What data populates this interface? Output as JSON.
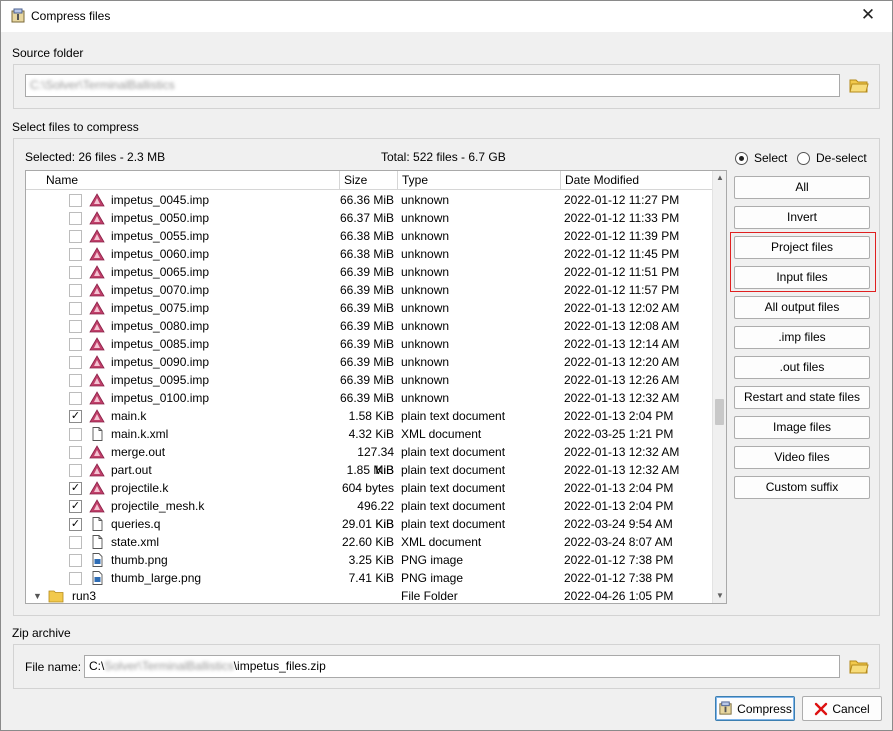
{
  "window": {
    "title": "Compress files",
    "close_glyph": "✕"
  },
  "source": {
    "group_label": "Source folder",
    "path_value": "C:\\Solver\\TerminalBallistics"
  },
  "select_files": {
    "group_label": "Select files to compress",
    "selected_summary": "Selected: 26 files - 2.3 MB",
    "total_summary": "Total: 522 files - 6.7 GB",
    "columns": [
      "Name",
      "Size",
      "Type",
      "Date Modified"
    ],
    "rows": [
      {
        "name": "impetus_0045.imp",
        "size": "66.36 MiB",
        "type": "unknown",
        "date": "2022-01-12 11:27 PM",
        "checked": false,
        "icon": "triangle-icon"
      },
      {
        "name": "impetus_0050.imp",
        "size": "66.37 MiB",
        "type": "unknown",
        "date": "2022-01-12 11:33 PM",
        "checked": false,
        "icon": "triangle-icon"
      },
      {
        "name": "impetus_0055.imp",
        "size": "66.38 MiB",
        "type": "unknown",
        "date": "2022-01-12 11:39 PM",
        "checked": false,
        "icon": "triangle-icon"
      },
      {
        "name": "impetus_0060.imp",
        "size": "66.38 MiB",
        "type": "unknown",
        "date": "2022-01-12 11:45 PM",
        "checked": false,
        "icon": "triangle-icon"
      },
      {
        "name": "impetus_0065.imp",
        "size": "66.39 MiB",
        "type": "unknown",
        "date": "2022-01-12 11:51 PM",
        "checked": false,
        "icon": "triangle-icon"
      },
      {
        "name": "impetus_0070.imp",
        "size": "66.39 MiB",
        "type": "unknown",
        "date": "2022-01-12 11:57 PM",
        "checked": false,
        "icon": "triangle-icon"
      },
      {
        "name": "impetus_0075.imp",
        "size": "66.39 MiB",
        "type": "unknown",
        "date": "2022-01-13 12:02 AM",
        "checked": false,
        "icon": "triangle-icon"
      },
      {
        "name": "impetus_0080.imp",
        "size": "66.39 MiB",
        "type": "unknown",
        "date": "2022-01-13 12:08 AM",
        "checked": false,
        "icon": "triangle-icon"
      },
      {
        "name": "impetus_0085.imp",
        "size": "66.39 MiB",
        "type": "unknown",
        "date": "2022-01-13 12:14 AM",
        "checked": false,
        "icon": "triangle-icon"
      },
      {
        "name": "impetus_0090.imp",
        "size": "66.39 MiB",
        "type": "unknown",
        "date": "2022-01-13 12:20 AM",
        "checked": false,
        "icon": "triangle-icon"
      },
      {
        "name": "impetus_0095.imp",
        "size": "66.39 MiB",
        "type": "unknown",
        "date": "2022-01-13 12:26 AM",
        "checked": false,
        "icon": "triangle-icon"
      },
      {
        "name": "impetus_0100.imp",
        "size": "66.39 MiB",
        "type": "unknown",
        "date": "2022-01-13 12:32 AM",
        "checked": false,
        "icon": "triangle-icon"
      },
      {
        "name": "main.k",
        "size": "1.58 KiB",
        "type": "plain text document",
        "date": "2022-01-13 2:04 PM",
        "checked": true,
        "icon": "triangle-icon"
      },
      {
        "name": "main.k.xml",
        "size": "4.32 KiB",
        "type": "XML document",
        "date": "2022-03-25 1:21 PM",
        "checked": false,
        "icon": "document-icon"
      },
      {
        "name": "merge.out",
        "size": "127.34 KiB",
        "type": "plain text document",
        "date": "2022-01-13 12:32 AM",
        "checked": false,
        "icon": "triangle-icon"
      },
      {
        "name": "part.out",
        "size": "1.85 MiB",
        "type": "plain text document",
        "date": "2022-01-13 12:32 AM",
        "checked": false,
        "icon": "triangle-icon"
      },
      {
        "name": "projectile.k",
        "size": "604 bytes",
        "type": "plain text document",
        "date": "2022-01-13 2:04 PM",
        "checked": true,
        "icon": "triangle-icon"
      },
      {
        "name": "projectile_mesh.k",
        "size": "496.22 KiB",
        "type": "plain text document",
        "date": "2022-01-13 2:04 PM",
        "checked": true,
        "icon": "triangle-icon"
      },
      {
        "name": "queries.q",
        "size": "29.01 KiB",
        "type": "plain text document",
        "date": "2022-03-24 9:54 AM",
        "checked": true,
        "icon": "document-icon"
      },
      {
        "name": "state.xml",
        "size": "22.60 KiB",
        "type": "XML document",
        "date": "2022-03-24 8:07 AM",
        "checked": false,
        "icon": "document-icon"
      },
      {
        "name": "thumb.png",
        "size": "3.25 KiB",
        "type": "PNG image",
        "date": "2022-01-12 7:38 PM",
        "checked": false,
        "icon": "image-icon"
      },
      {
        "name": "thumb_large.png",
        "size": "7.41 KiB",
        "type": "PNG image",
        "date": "2022-01-12 7:38 PM",
        "checked": false,
        "icon": "image-icon"
      }
    ],
    "folder_row": {
      "name": "run3",
      "type": "File Folder",
      "date": "2022-04-26 1:05 PM"
    },
    "radio_select": "Select",
    "radio_deselect": "De-select",
    "buttons": [
      "All",
      "Invert",
      "Project files",
      "Input files",
      "All output files",
      ".imp files",
      ".out files",
      "Restart and state files",
      "Image files",
      "Video files",
      "Custom suffix"
    ]
  },
  "zip": {
    "group_label": "Zip archive",
    "file_name_label": "File name:",
    "path_prefix": "C:\\",
    "path_hidden": "Solver\\TerminalBallistics",
    "path_suffix": "\\impetus_files.zip"
  },
  "footer": {
    "compress_label": "Compress",
    "cancel_label": "Cancel"
  },
  "colors": {
    "highlight_border": "#e02020",
    "imp_icon": "#c0406a",
    "folder_icon": "#f2c94c"
  }
}
